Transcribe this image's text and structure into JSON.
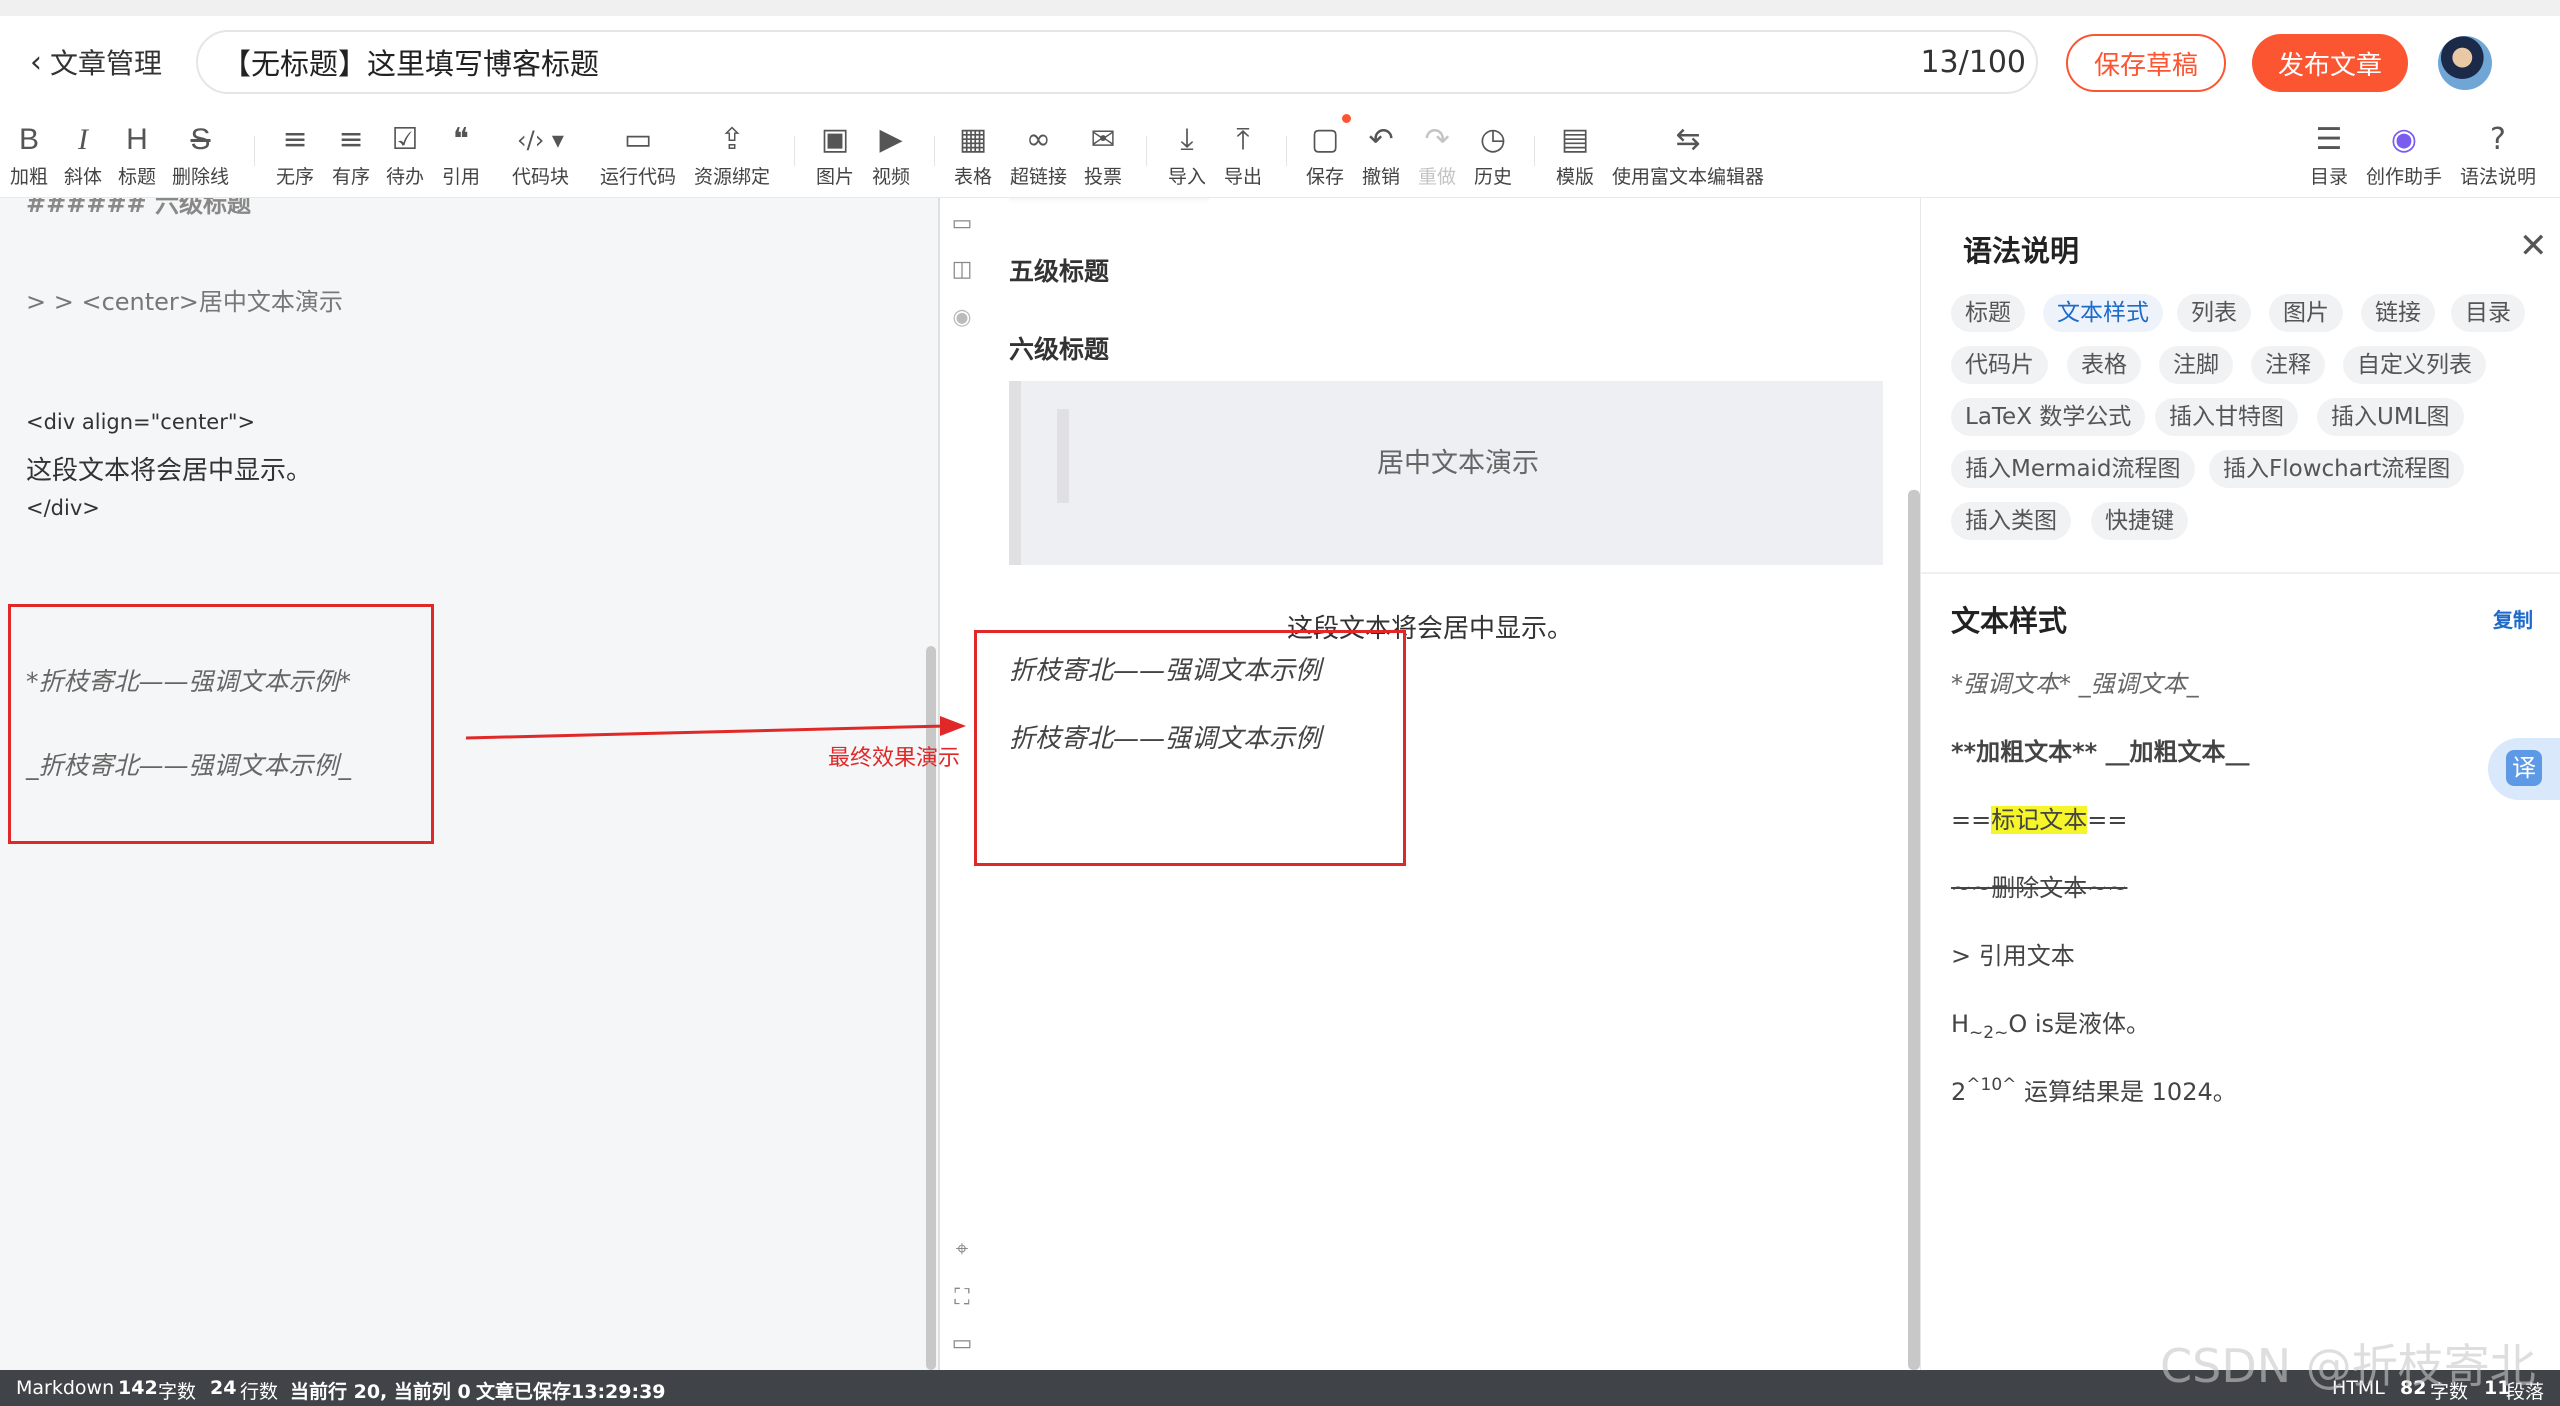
{
  "header": {
    "back_label": "文章管理",
    "title": "【无标题】这里填写博客标题",
    "title_count": "13/100",
    "save_draft": "保存草稿",
    "publish": "发布文章"
  },
  "toolbar": {
    "items": [
      {
        "icon": "B",
        "label": "加粗"
      },
      {
        "icon": "I",
        "label": "斜体"
      },
      {
        "icon": "H",
        "label": "标题"
      },
      {
        "icon": "S",
        "label": "删除线"
      },
      {
        "icon": "≡",
        "label": "无序"
      },
      {
        "icon": "≡",
        "label": "有序"
      },
      {
        "icon": "☑",
        "label": "待办"
      },
      {
        "icon": "❝",
        "label": "引用"
      },
      {
        "icon": "‹/› ▾",
        "label": "代码块"
      },
      {
        "icon": "▭",
        "label": "运行代码"
      },
      {
        "icon": "⇪",
        "label": "资源绑定"
      },
      {
        "icon": "▣",
        "label": "图片"
      },
      {
        "icon": "▶",
        "label": "视频"
      },
      {
        "icon": "▦",
        "label": "表格"
      },
      {
        "icon": "∞",
        "label": "超链接"
      },
      {
        "icon": "✉",
        "label": "投票"
      },
      {
        "icon": "⤓",
        "label": "导入"
      },
      {
        "icon": "⤒",
        "label": "导出"
      },
      {
        "icon": "▢",
        "label": "保存"
      },
      {
        "icon": "↶",
        "label": "撤销"
      },
      {
        "icon": "↷",
        "label": "重做"
      },
      {
        "icon": "◷",
        "label": "历史"
      },
      {
        "icon": "▤",
        "label": "模版"
      },
      {
        "icon": "⇆",
        "label": "使用富文本编辑器"
      },
      {
        "icon": "☰",
        "label": "目录"
      },
      {
        "icon": "◉",
        "label": "创作助手"
      },
      {
        "icon": "?",
        "label": "语法说明"
      }
    ]
  },
  "editor": {
    "lines": [
      {
        "text": "###### 六级标题"
      },
      {
        "text": "> > <center>居中文本演示"
      },
      {
        "text": "<div align=\"center\">"
      },
      {
        "text": "这段文本将会居中显示。"
      },
      {
        "text": "</div>"
      },
      {
        "text": "*折枝寄北——强调文本示例*"
      },
      {
        "text": "_折枝寄北——强调文本示例_"
      }
    ]
  },
  "preview": {
    "h5": "五级标题",
    "h6": "六级标题",
    "quote": "居中文本演示",
    "center": "这段文本将会居中显示。",
    "em1": "折枝寄北——强调文本示例",
    "em2": "折枝寄北——强调文本示例"
  },
  "annotation": "最终效果演示",
  "syntax": {
    "title": "语法说明",
    "chips": [
      "标题",
      "文本样式",
      "列表",
      "图片",
      "链接",
      "目录",
      "代码片",
      "表格",
      "注脚",
      "注释",
      "自定义列表",
      "LaTeX 数学公式",
      "插入甘特图",
      "插入UML图",
      "插入Mermaid流程图",
      "插入Flowchart流程图",
      "插入类图",
      "快捷键"
    ],
    "active_chip": "文本样式",
    "section_title": "文本样式",
    "copy": "复制",
    "examples": {
      "em": "*强调文本* _强调文本_",
      "bold": "**加粗文本** __加粗文本__",
      "mark_pre": "==",
      "mark_text": "标记文本",
      "mark_post": "==",
      "del": "~~删除文本~~",
      "quote": "> 引用文本",
      "sub_pre": "H",
      "sub_mid": "~2~",
      "sub_post": "O is是液体。",
      "sup_pre": "2",
      "sup_mid": "^10^",
      "sup_post": " 运算结果是 1024。"
    },
    "translate": "译"
  },
  "status": {
    "mode": "Markdown",
    "chars": "142",
    "chars_unit": "字数",
    "lines": "24",
    "lines_unit": "行数",
    "cursor": "当前行 20, 当前列 0",
    "saved": "文章已保存13:29:39",
    "right_mode": "HTML",
    "right_chars": "82",
    "right_chars_unit": "字数",
    "right_paras": "11",
    "right_paras_unit": "段落"
  },
  "watermark": "CSDN @折枝寄北"
}
